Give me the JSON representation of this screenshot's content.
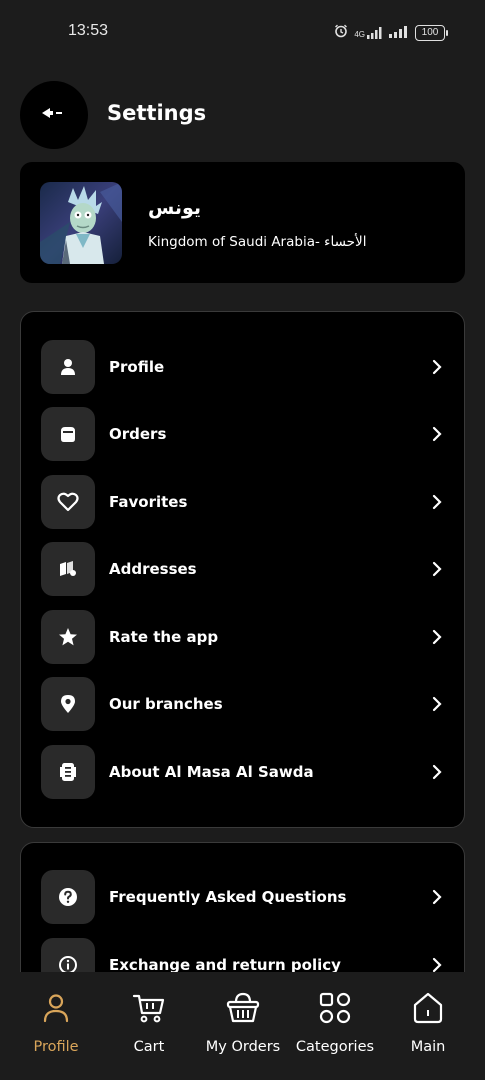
{
  "status_bar": {
    "time": "13:53",
    "battery": "100",
    "network": "4G"
  },
  "header": {
    "title": "Settings",
    "back_icon": "back-arrow-icon"
  },
  "user": {
    "name": "يونس",
    "location": "Kingdom of Saudi Arabia- الأحساء"
  },
  "menu_primary": [
    {
      "label": "Profile",
      "icon": "person-icon"
    },
    {
      "label": "Orders",
      "icon": "bag-icon"
    },
    {
      "label": "Favorites",
      "icon": "heart-icon"
    },
    {
      "label": "Addresses",
      "icon": "map-icon"
    },
    {
      "label": "Rate the app",
      "icon": "star-icon"
    },
    {
      "label": "Our branches",
      "icon": "location-pin-icon"
    },
    {
      "label": "About Al Masa Al Sawda",
      "icon": "document-icon"
    }
  ],
  "menu_secondary": [
    {
      "label": "Frequently Asked Questions",
      "icon": "question-icon"
    },
    {
      "label": "Exchange and return policy",
      "icon": "info-icon"
    }
  ],
  "bottom_nav": [
    {
      "label": "Profile",
      "icon": "person-outline-icon",
      "active": true
    },
    {
      "label": "Cart",
      "icon": "cart-icon",
      "active": false
    },
    {
      "label": "My Orders",
      "icon": "basket-icon",
      "active": false
    },
    {
      "label": "Categories",
      "icon": "grid-icon",
      "active": false
    },
    {
      "label": "Main",
      "icon": "home-icon",
      "active": false
    }
  ],
  "colors": {
    "background": "#1c1c1c",
    "card": "#000000",
    "icon_box": "#2a2a2a",
    "accent": "#d9a55a"
  }
}
